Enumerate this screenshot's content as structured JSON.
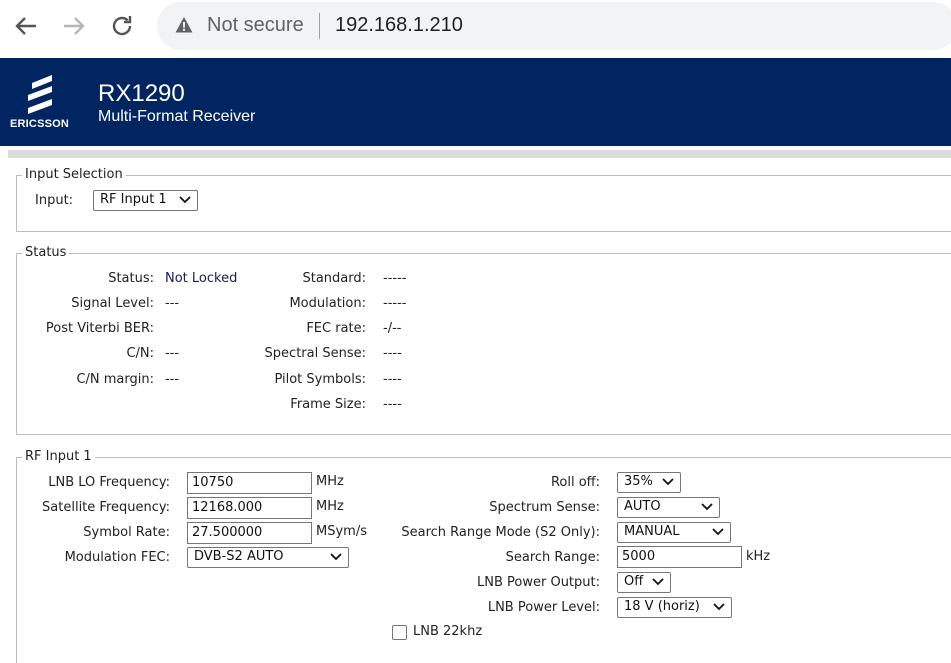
{
  "browser": {
    "security_label": "Not secure",
    "url": "192.168.1.210",
    "icons": [
      "back-arrow-icon",
      "forward-arrow-icon",
      "reload-icon",
      "warning-icon"
    ]
  },
  "header": {
    "logo_text": "ERICSSON",
    "title": "RX1290",
    "subtitle": "Multi-Format Receiver",
    "background_color": "#002561"
  },
  "input_selection": {
    "legend": "Input Selection",
    "input_label": "Input:",
    "input_value": "RF Input 1"
  },
  "status": {
    "legend": "Status",
    "left": [
      {
        "label": "Status:",
        "value": "Not Locked"
      },
      {
        "label": "Signal Level:",
        "value": "---"
      },
      {
        "label": "Post Viterbi BER:",
        "value": ""
      },
      {
        "label": "C/N:",
        "value": "---"
      },
      {
        "label": "C/N margin:",
        "value": "---"
      }
    ],
    "right": [
      {
        "label": "Standard:",
        "value": "-----"
      },
      {
        "label": "Modulation:",
        "value": "-----"
      },
      {
        "label": "FEC rate:",
        "value": "-/--"
      },
      {
        "label": "Spectral Sense:",
        "value": "----"
      },
      {
        "label": "Pilot Symbols:",
        "value": "----"
      },
      {
        "label": "Frame Size:",
        "value": "----"
      }
    ]
  },
  "rf_input": {
    "legend": "RF Input 1",
    "lnb_lo_freq": {
      "label": "LNB LO Frequency:",
      "value": "10750",
      "unit": "MHz"
    },
    "sat_freq": {
      "label": "Satellite Frequency:",
      "value": "12168.000",
      "unit": "MHz"
    },
    "symbol_rate": {
      "label": "Symbol Rate:",
      "value": "27.500000",
      "unit": "MSym/s"
    },
    "mod_fec": {
      "label": "Modulation FEC:",
      "value": "DVB-S2 AUTO"
    },
    "roll_off": {
      "label": "Roll off:",
      "value": "35%"
    },
    "spectrum_sense": {
      "label": "Spectrum Sense:",
      "value": "AUTO"
    },
    "search_mode": {
      "label": "Search Range Mode (S2 Only):",
      "value": "MANUAL"
    },
    "search_range": {
      "label": "Search Range:",
      "value": "5000",
      "unit": "kHz"
    },
    "lnb_power_output": {
      "label": "LNB Power Output:",
      "value": "Off"
    },
    "lnb_power_level": {
      "label": "LNB Power Level:",
      "value": "18 V (horiz)"
    },
    "lnb_22khz": {
      "label": "LNB 22khz",
      "checked": false
    }
  }
}
